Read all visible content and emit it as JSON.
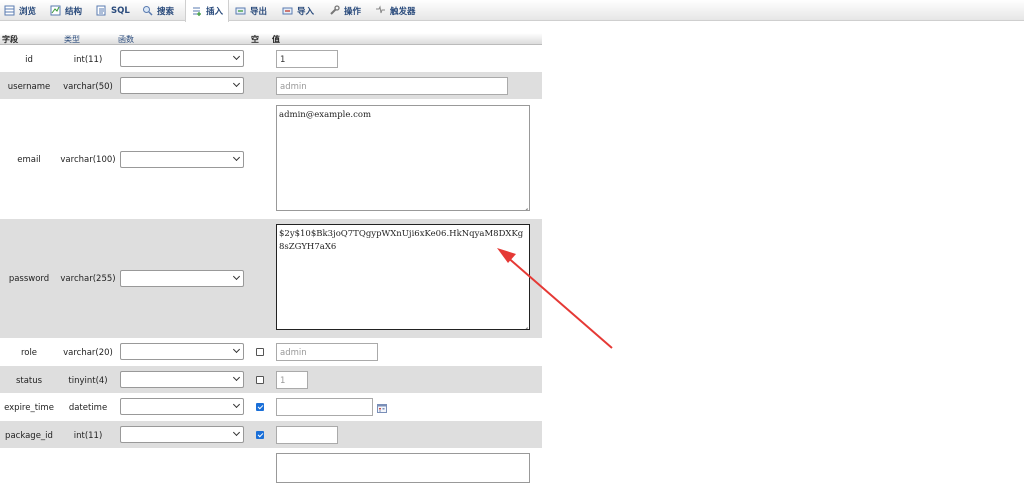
{
  "toolbar": {
    "tabs": [
      {
        "label": "浏览",
        "icon": "browse-icon"
      },
      {
        "label": "结构",
        "icon": "structure-icon"
      },
      {
        "label": "SQL",
        "icon": "sql-icon"
      },
      {
        "label": "搜索",
        "icon": "search-icon"
      },
      {
        "label": "插入",
        "icon": "insert-icon",
        "active": true
      },
      {
        "label": "导出",
        "icon": "export-icon"
      },
      {
        "label": "导入",
        "icon": "import-icon"
      },
      {
        "label": "操作",
        "icon": "wrench-icon"
      },
      {
        "label": "触发器",
        "icon": "trigger-icon"
      }
    ]
  },
  "table": {
    "headers": {
      "field": "字段",
      "type": "类型",
      "function": "函数",
      "null": "空",
      "value": "值"
    },
    "rows": [
      {
        "name": "id",
        "type": "int(11)",
        "function": "",
        "nullable": false,
        "value": "1",
        "is_placeholder": false
      },
      {
        "name": "username",
        "type": "varchar(50)",
        "function": "",
        "nullable": false,
        "value": "admin",
        "is_placeholder": true
      },
      {
        "name": "email",
        "type": "varchar(100)",
        "function": "",
        "nullable": false,
        "value": "admin@example.com",
        "is_placeholder": false
      },
      {
        "name": "password",
        "type": "varchar(255)",
        "function": "",
        "nullable": false,
        "value": "$2y$10$Bk3joQ7TQgypWXnUji6xKe06.HkNqyaM8DXKg8sZGYH7aX6",
        "is_placeholder": false
      },
      {
        "name": "role",
        "type": "varchar(20)",
        "function": "",
        "nullable": true,
        "null_checked": false,
        "value": "admin",
        "is_placeholder": true
      },
      {
        "name": "status",
        "type": "tinyint(4)",
        "function": "",
        "nullable": true,
        "null_checked": false,
        "value": "1",
        "is_placeholder": true
      },
      {
        "name": "expire_time",
        "type": "datetime",
        "function": "",
        "nullable": true,
        "null_checked": true,
        "value": "",
        "is_placeholder": false
      },
      {
        "name": "package_id",
        "type": "int(11)",
        "function": "",
        "nullable": true,
        "null_checked": true,
        "value": "",
        "is_placeholder": false
      }
    ]
  },
  "colors": {
    "arrow": "#e53935",
    "link": "#2a4b7c",
    "alt_row": "#dedede",
    "checkbox": "#1a6fd8"
  }
}
